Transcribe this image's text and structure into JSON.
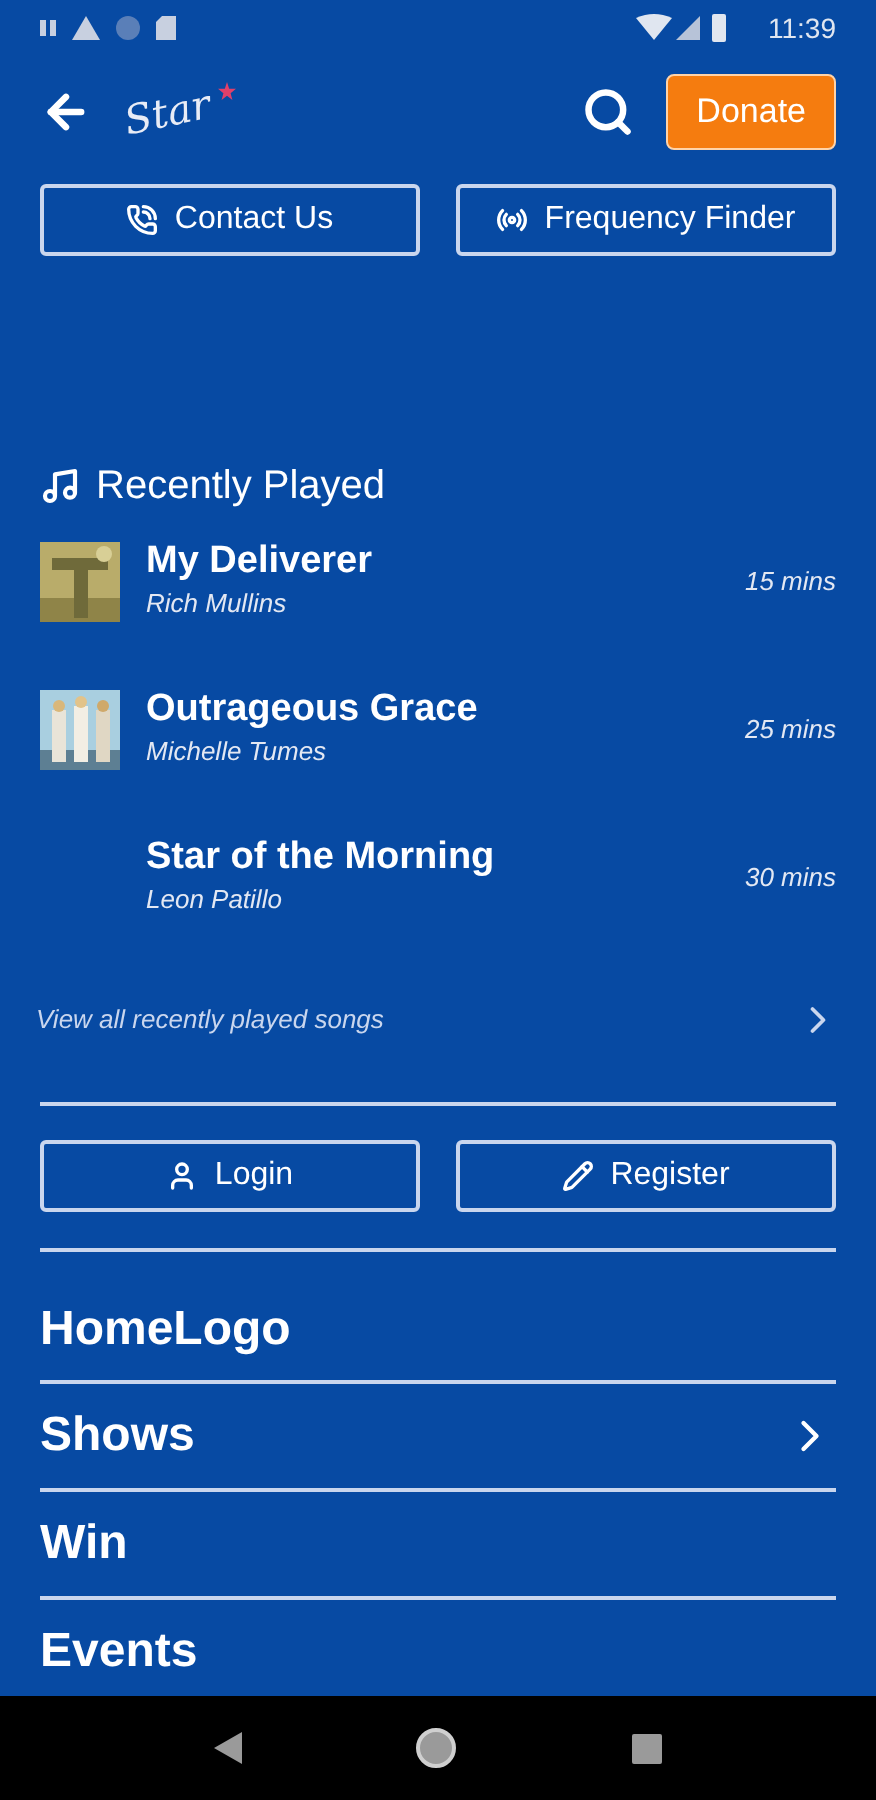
{
  "status_bar": {
    "time": "11:39"
  },
  "header": {
    "logo": "Star",
    "donate": "Donate"
  },
  "quick_buttons": [
    {
      "label": "Contact Us",
      "kind": "phone"
    },
    {
      "label": "Frequency Finder",
      "kind": "broadcast"
    }
  ],
  "recently_played": {
    "title": "Recently Played",
    "songs": [
      {
        "title": "My Deliverer",
        "artist": "Rich Mullins",
        "time": "15 mins",
        "art": true
      },
      {
        "title": "Outrageous Grace",
        "artist": "Michelle Tumes",
        "time": "25 mins",
        "art": true
      },
      {
        "title": "Star of the Morning",
        "artist": "Leon Patillo",
        "time": "30 mins",
        "art": false
      }
    ],
    "view_all": "View all recently played songs"
  },
  "account_buttons": [
    {
      "label": "Login",
      "kind": "user"
    },
    {
      "label": "Register",
      "kind": "pencil"
    }
  ],
  "menu": [
    {
      "label": "HomeLogo",
      "expandable": false
    },
    {
      "label": "Shows",
      "expandable": true
    },
    {
      "label": "Win",
      "expandable": false
    },
    {
      "label": "Events",
      "expandable": false
    }
  ]
}
